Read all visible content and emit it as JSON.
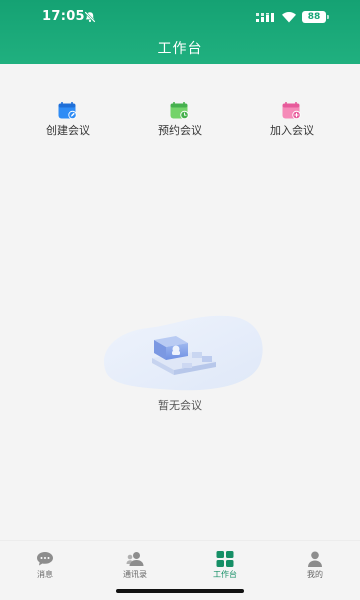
{
  "status_bar": {
    "time": "17:05",
    "battery": "88"
  },
  "header": {
    "title": "工作台"
  },
  "actions": [
    {
      "label": "创建会议",
      "icon": "create-meeting-icon",
      "color": "#2f8cf5"
    },
    {
      "label": "预约会议",
      "icon": "schedule-meeting-icon",
      "color": "#52c25a"
    },
    {
      "label": "加入会议",
      "icon": "join-meeting-icon",
      "color": "#f06aa8"
    }
  ],
  "empty_state": {
    "text": "暂无会议",
    "icon": "empty-meeting-illustration"
  },
  "tabbar": {
    "items": [
      {
        "label": "消息",
        "icon": "message-bubble-icon",
        "active": false
      },
      {
        "label": "通讯录",
        "icon": "contacts-icon",
        "active": false
      },
      {
        "label": "工作台",
        "icon": "workspace-grid-icon",
        "active": true
      },
      {
        "label": "我的",
        "icon": "person-icon",
        "active": false
      }
    ]
  },
  "colors": {
    "brand": "#1aa778",
    "active_tab": "#168f66",
    "background": "#f4f4f4"
  }
}
